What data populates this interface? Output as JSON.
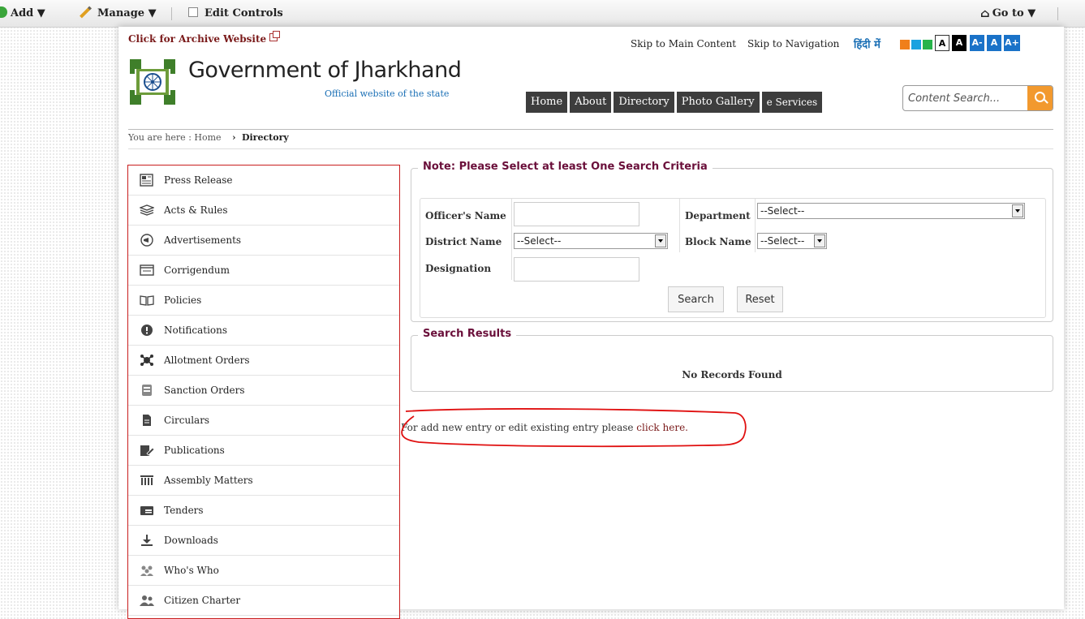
{
  "admin_bar": {
    "add_label": "Add ▼",
    "manage_label": "Manage ▼",
    "edit_controls_label": "Edit Controls",
    "goto_label": "Go to ▼"
  },
  "header": {
    "archive_link": "Click for Archive Website",
    "skip_main": "Skip to Main Content",
    "skip_nav": "Skip to Navigation",
    "hindi_link": "हिंदी में",
    "theme_colors": [
      "#f07f1a",
      "#1aa2e0",
      "#27b34a"
    ],
    "font_buttons": [
      "A",
      "A",
      "A-",
      "A",
      "A+"
    ],
    "site_title": "Government of Jharkhand",
    "site_subtitle": "Official website of the state",
    "nav": [
      "Home",
      "About",
      "Directory",
      "Photo Gallery",
      "e Services"
    ],
    "search_placeholder": "Content Search..."
  },
  "breadcrumb": {
    "prefix": "You are here :",
    "home": "Home",
    "current": "Directory"
  },
  "sidebar": {
    "items": [
      {
        "label": "Press Release",
        "icon": "newspaper-icon"
      },
      {
        "label": "Acts & Rules",
        "icon": "books-icon"
      },
      {
        "label": "Advertisements",
        "icon": "megaphone-icon"
      },
      {
        "label": "Corrigendum",
        "icon": "document-icon"
      },
      {
        "label": "Policies",
        "icon": "open-book-icon"
      },
      {
        "label": "Notifications",
        "icon": "alert-icon"
      },
      {
        "label": "Allotment Orders",
        "icon": "network-icon"
      },
      {
        "label": "Sanction Orders",
        "icon": "stamp-icon"
      },
      {
        "label": "Circulars",
        "icon": "file-icon"
      },
      {
        "label": "Publications",
        "icon": "edit-doc-icon"
      },
      {
        "label": "Assembly Matters",
        "icon": "pillars-icon"
      },
      {
        "label": "Tenders",
        "icon": "tender-icon"
      },
      {
        "label": "Downloads",
        "icon": "download-icon"
      },
      {
        "label": "Who's Who",
        "icon": "people-group-icon"
      },
      {
        "label": "Citizen Charter",
        "icon": "users-icon"
      }
    ]
  },
  "criteria": {
    "legend": "Note: Please Select at least One Search Criteria",
    "officer_label": "Officer's Name",
    "officer_value": "",
    "department_label": "Department",
    "department_value": "--Select--",
    "district_label": "District Name",
    "district_value": "--Select--",
    "block_label": "Block Name",
    "block_value": "--Select--",
    "designation_label": "Designation",
    "designation_value": "",
    "search_button": "Search",
    "reset_button": "Reset"
  },
  "results": {
    "legend": "Search Results",
    "message": "No Records Found"
  },
  "note": {
    "text": "For add new entry or edit existing entry please ",
    "link": "click here."
  },
  "colors": {
    "accent_red": "#c81e1e",
    "legend_text": "#6a0f3a",
    "search_orange": "#f2992e",
    "nav_bg": "#3d3d3d"
  }
}
